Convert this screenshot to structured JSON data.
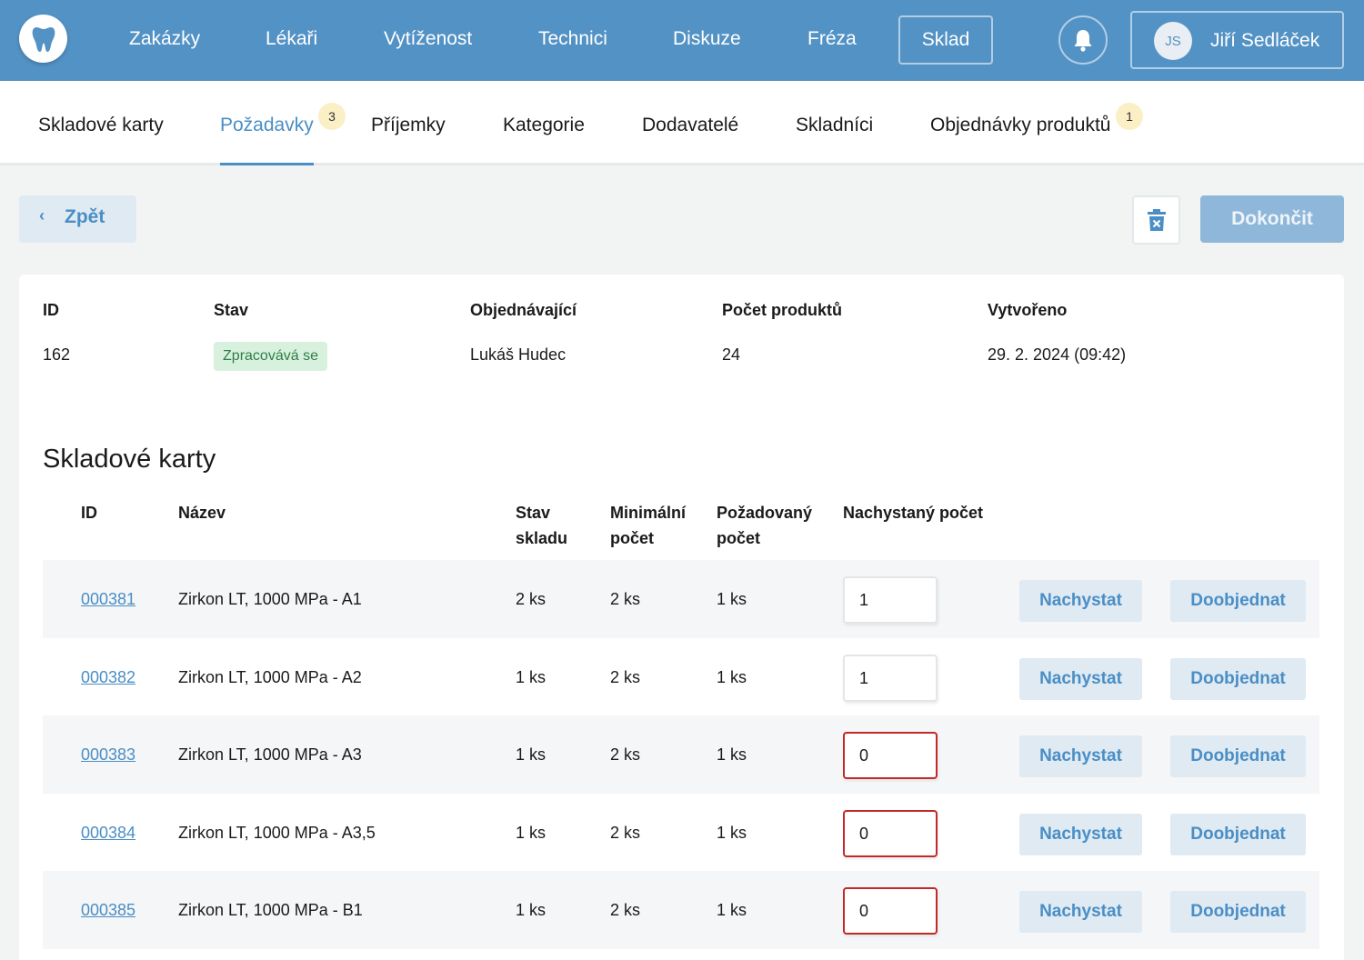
{
  "topnav": {
    "items": [
      "Zakázky",
      "Lékaři",
      "Vytíženost",
      "Technici",
      "Diskuze",
      "Fréza"
    ],
    "active": "Sklad",
    "user": {
      "initials": "JS",
      "name": "Jiří Sedláček"
    }
  },
  "subnav": {
    "tabs": [
      {
        "label": "Skladové karty"
      },
      {
        "label": "Požadavky",
        "badge": "3"
      },
      {
        "label": "Příjemky"
      },
      {
        "label": "Kategorie"
      },
      {
        "label": "Dodavatelé"
      },
      {
        "label": "Skladníci"
      },
      {
        "label": "Objednávky produktů",
        "badge": "1"
      }
    ],
    "active_tab": "Požadavky"
  },
  "actions": {
    "back_label": "Zpět",
    "back_chevron": "‹",
    "finish_label": "Dokončit"
  },
  "request": {
    "headers": {
      "id": "ID",
      "status": "Stav",
      "orderer": "Objednávající",
      "count": "Počet produktů",
      "created": "Vytvořeno"
    },
    "id": "162",
    "status": "Zpracovává se",
    "orderer": "Lukáš Hudec",
    "count": "24",
    "created": "29. 2. 2024 (09:42)"
  },
  "cards": {
    "title": "Skladové karty",
    "columns": {
      "id": "ID",
      "name": "Název",
      "stock_1": "Stav",
      "stock_2": "skladu",
      "min_1": "Minimální",
      "min_2": "počet",
      "req_1": "Požadovaný",
      "req_2": "počet",
      "prepared": "Nachystaný počet"
    },
    "prepare_label": "Nachystat",
    "reorder_label": "Doobjednat",
    "rows": [
      {
        "id": "000381",
        "name": "Zirkon LT, 1000 MPa - A1",
        "stock": "2 ks",
        "min": "2 ks",
        "requested": "1 ks",
        "prepared": "1",
        "error": false
      },
      {
        "id": "000382",
        "name": "Zirkon LT, 1000 MPa - A2",
        "stock": "1 ks",
        "min": "2 ks",
        "requested": "1 ks",
        "prepared": "1",
        "error": false
      },
      {
        "id": "000383",
        "name": "Zirkon LT, 1000 MPa - A3",
        "stock": "1 ks",
        "min": "2 ks",
        "requested": "1 ks",
        "prepared": "0",
        "error": true
      },
      {
        "id": "000384",
        "name": "Zirkon LT, 1000 MPa - A3,5",
        "stock": "1 ks",
        "min": "2 ks",
        "requested": "1 ks",
        "prepared": "0",
        "error": true
      },
      {
        "id": "000385",
        "name": "Zirkon LT, 1000 MPa - B1",
        "stock": "1 ks",
        "min": "2 ks",
        "requested": "1 ks",
        "prepared": "0",
        "error": true
      }
    ]
  },
  "colors": {
    "primary": "#5392c5",
    "link": "#4a8ec5",
    "error": "#c42828",
    "success_bg": "#d8f1df"
  }
}
